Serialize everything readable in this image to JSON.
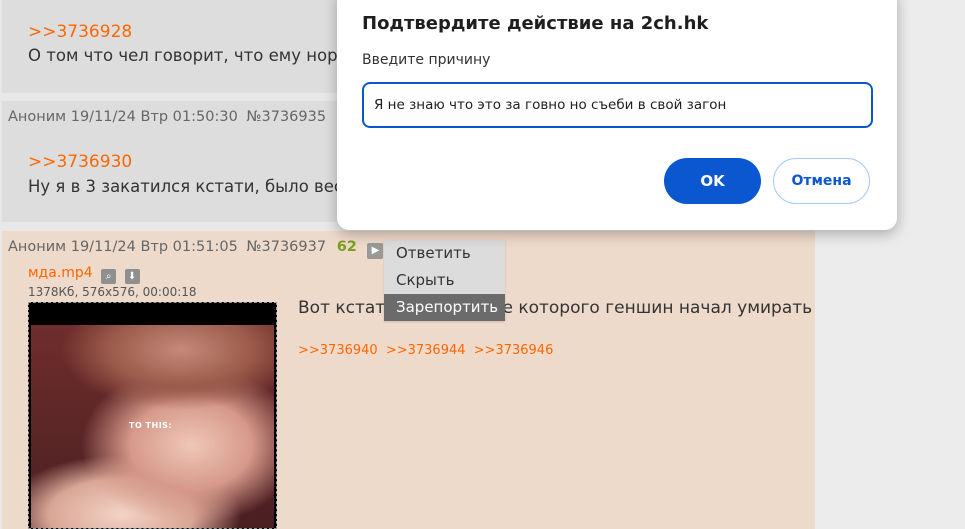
{
  "posts": [
    {
      "reflink": ">>3736928",
      "text": "О том что чел говорит, что ему нор"
    },
    {
      "author": "Аноним",
      "date": "19/11/24 Втр 01:50:30",
      "number": "№3736935",
      "reflink": ">>3736930",
      "text": "Ну я в 3 закатился кстати, было вес"
    },
    {
      "author": "Аноним",
      "date": "19/11/24 Втр 01:51:05",
      "number": "№3736937",
      "count": "62",
      "file_name": "мда.mp4",
      "file_meta": "1378Кб, 576x576, 00:00:18",
      "thumb_caption": "TO THIS:",
      "text": "Вот кстати видео после которого геншин начал умирать",
      "replies": [
        ">>3736940",
        ">>3736944",
        ">>3736946"
      ]
    }
  ],
  "context_menu": {
    "items": [
      "Ответить",
      "Скрыть",
      "Зарепортить"
    ],
    "active_index": 2
  },
  "dialog": {
    "title": "Подтвердите действие на 2ch.hk",
    "label": "Введите причину",
    "input_value": "Я не знаю что это за говно но съеби в свой загон",
    "ok_label": "OK",
    "cancel_label": "Отмена"
  },
  "icons": {
    "play": "play-icon",
    "search": "search-icon",
    "download": "download-icon"
  },
  "colors": {
    "reflink": "#ff6600",
    "post_bg": "#dddddd",
    "op_post_bg": "#eedacb",
    "accent": "#0b57d0",
    "menu_active": "#6b6b6b"
  }
}
